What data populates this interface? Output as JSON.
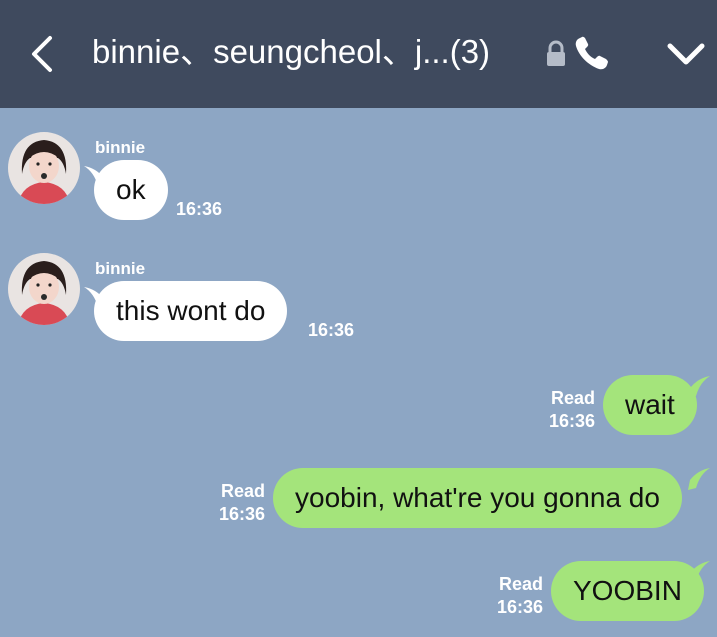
{
  "header": {
    "title": "binnie、seungcheol、j...(3)",
    "icons": [
      "back-icon",
      "lock-icon",
      "phone-icon",
      "chevron-down-icon"
    ],
    "background": "#3f4a5e"
  },
  "chat": {
    "background": "#8da6c4",
    "incoming_bubble_color": "#ffffff",
    "outgoing_bubble_color": "#a4e47b",
    "messages": [
      {
        "direction": "in",
        "sender": "binnie",
        "text": "ok",
        "time": "16:36"
      },
      {
        "direction": "in",
        "sender": "binnie",
        "text": "this wont do",
        "time": "16:36"
      },
      {
        "direction": "out",
        "text": "wait",
        "status": "Read",
        "time": "16:36"
      },
      {
        "direction": "out",
        "text": "yoobin, what're you gonna do",
        "status": "Read",
        "time": "16:36"
      },
      {
        "direction": "out",
        "text": "YOOBIN",
        "status": "Read",
        "time": "16:36"
      }
    ]
  }
}
